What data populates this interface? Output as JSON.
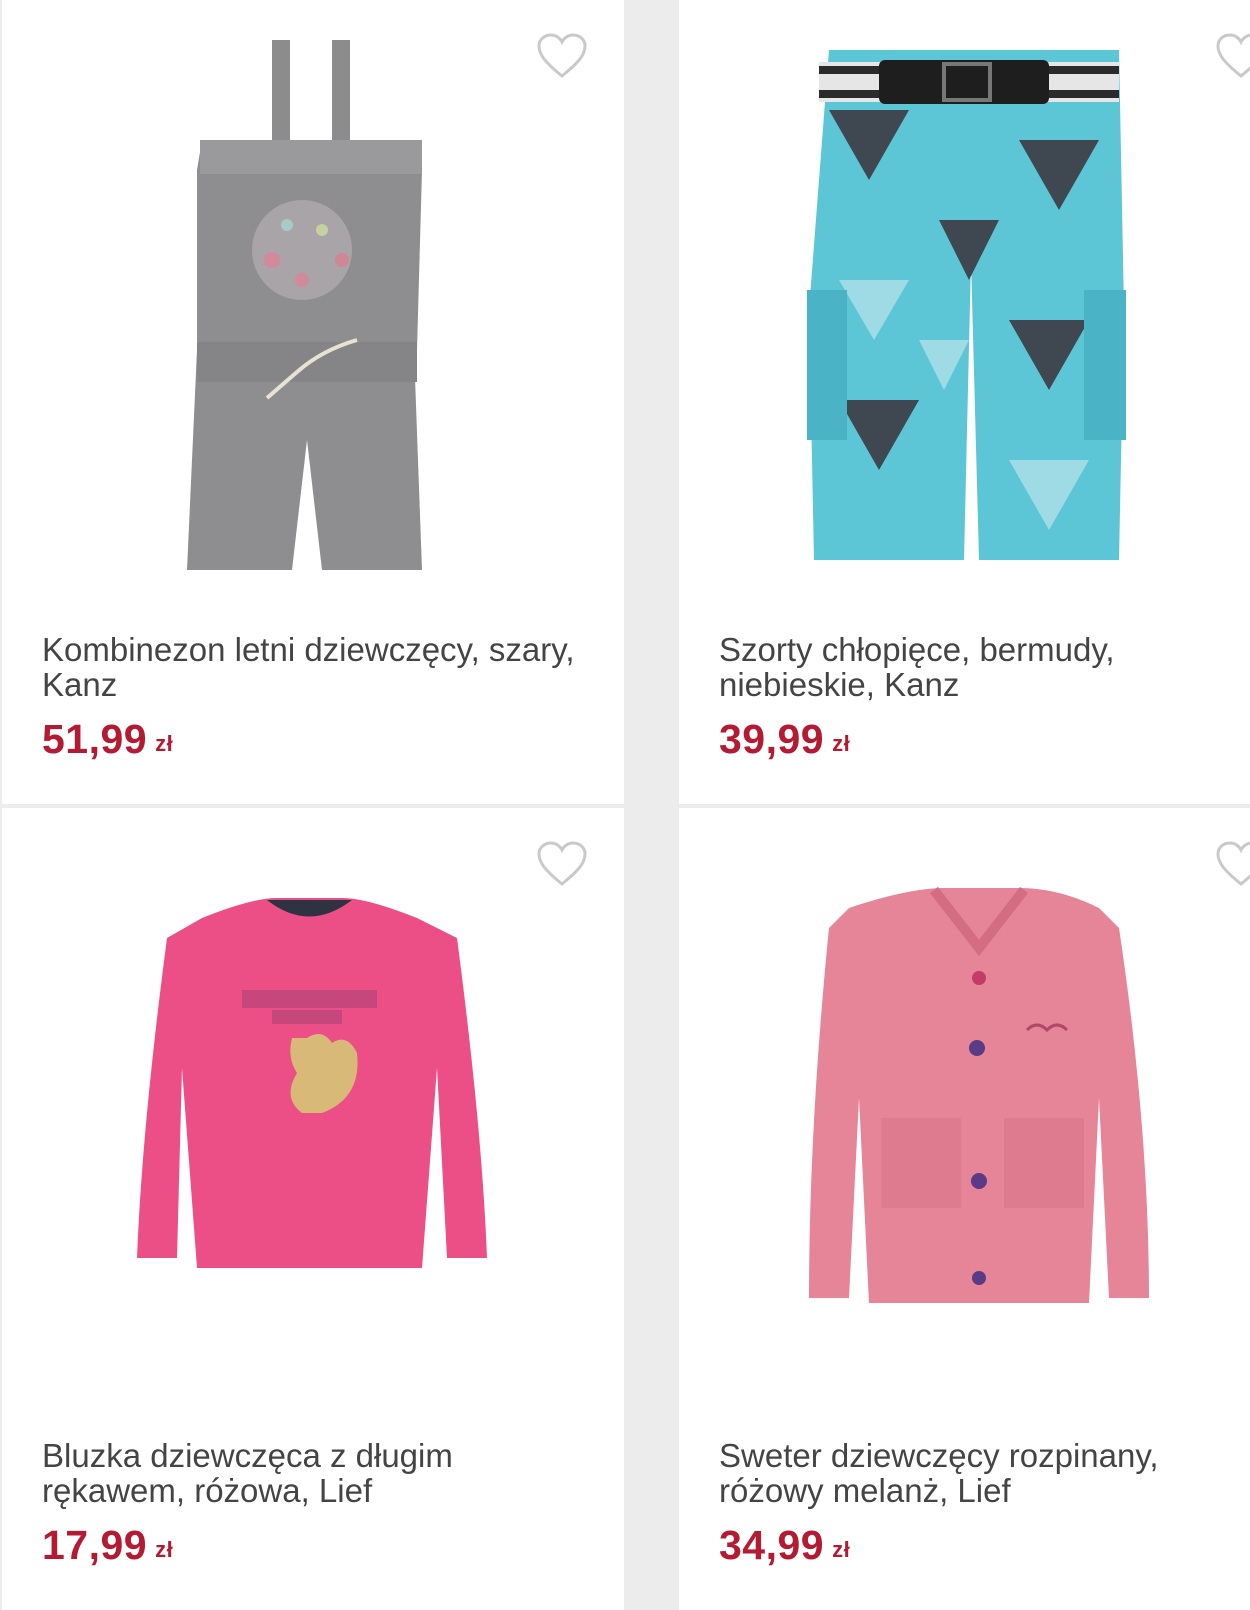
{
  "products": [
    {
      "title": "Kombinezon letni dziewczęcy, szary, Kanz",
      "price": "51,99",
      "currency": "zł",
      "image_icon": "gray-romper-image"
    },
    {
      "title": "Szorty chłopięce, bermudy, niebieskie, Kanz",
      "price": "39,99",
      "currency": "zł",
      "image_icon": "blue-shorts-image"
    },
    {
      "title": "Bluzka dziewczęca z długim rękawem, różowa, Lief",
      "price": "17,99",
      "currency": "zł",
      "image_icon": "pink-blouse-image"
    },
    {
      "title": "Sweter dziewczęcy rozpinany, różowy melanż, Lief",
      "price": "34,99",
      "currency": "zł",
      "image_icon": "pink-cardigan-image"
    }
  ],
  "favorite_icon": "heart-outline-icon",
  "colors": {
    "price": "#b51a33",
    "title": "#444444",
    "background": "#ececec",
    "card": "#ffffff"
  }
}
